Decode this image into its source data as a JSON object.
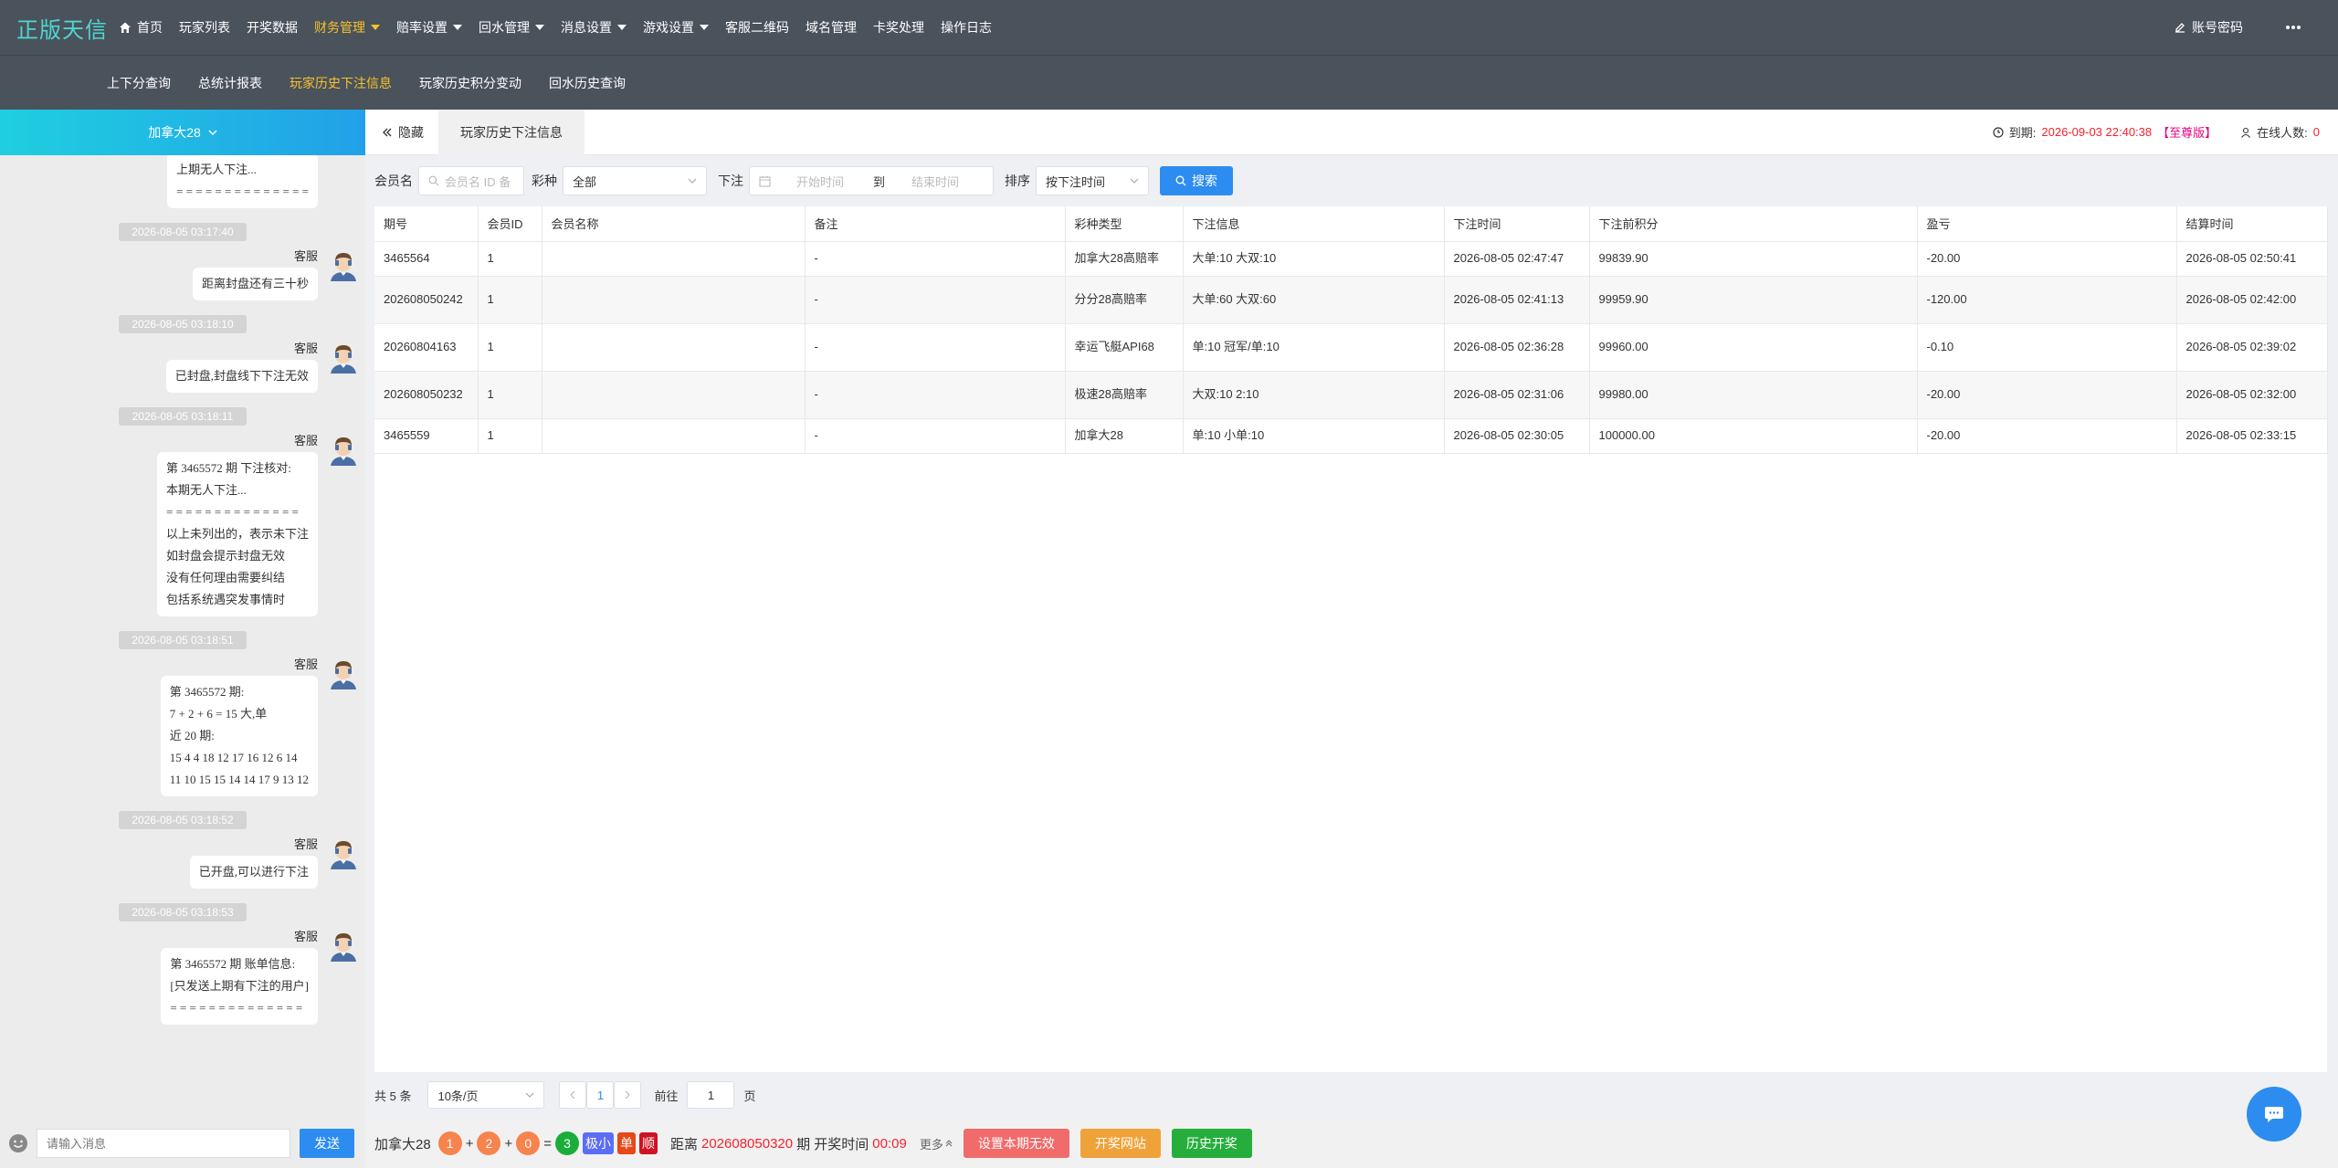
{
  "topbar": {
    "logo": "正版天信",
    "nav": [
      {
        "label": "首页",
        "active": false,
        "caret": false,
        "icon": "home-icon"
      },
      {
        "label": "玩家列表",
        "active": false,
        "caret": false
      },
      {
        "label": "开奖数据",
        "active": false,
        "caret": false
      },
      {
        "label": "财务管理",
        "active": true,
        "caret": true
      },
      {
        "label": "赔率设置",
        "active": false,
        "caret": true
      },
      {
        "label": "回水管理",
        "active": false,
        "caret": true
      },
      {
        "label": "消息设置",
        "active": false,
        "caret": true
      },
      {
        "label": "游戏设置",
        "active": false,
        "caret": true
      },
      {
        "label": "客服二维码",
        "active": false,
        "caret": false
      },
      {
        "label": "域名管理",
        "active": false,
        "caret": false
      },
      {
        "label": "卡奖处理",
        "active": false,
        "caret": false
      },
      {
        "label": "操作日志",
        "active": false,
        "caret": false
      }
    ],
    "account_label": "账号密码",
    "more_icon": "more-icon"
  },
  "subnav": [
    {
      "label": "上下分查询",
      "active": false
    },
    {
      "label": "总统计报表",
      "active": false
    },
    {
      "label": "玩家历史下注信息",
      "active": true
    },
    {
      "label": "玩家历史积分变动",
      "active": false
    },
    {
      "label": "回水历史查询",
      "active": false
    }
  ],
  "chat": {
    "title": "加拿大28",
    "messages": [
      {
        "timestamp": "",
        "sender": "",
        "text": "上期无人下注...\n= = = = = = = = = = = = = ="
      },
      {
        "timestamp": "2026-08-05 03:17:40",
        "sender": "客服",
        "text": "距离封盘还有三十秒"
      },
      {
        "timestamp": "2026-08-05 03:18:10",
        "sender": "客服",
        "text": "已封盘,封盘线下下注无效"
      },
      {
        "timestamp": "2026-08-05 03:18:11",
        "sender": "客服",
        "text": "第 3465572 期 下注核对:\n本期无人下注...\n= = = = = = = = = = = = = =\n以上未列出的，表示未下注\n如封盘会提示封盘无效\n没有任何理由需要纠结\n包括系统遇突发事情时"
      },
      {
        "timestamp": "2026-08-05 03:18:51",
        "sender": "客服",
        "text": "第 3465572 期:\n7 + 2 + 6 = 15 大,单\n近 20 期:\n15 4 4 18 12 17 16 12 6 14\n11 10 15 15 14 14 17 9 13 12"
      },
      {
        "timestamp": "2026-08-05 03:18:52",
        "sender": "客服",
        "text": "已开盘,可以进行下注"
      },
      {
        "timestamp": "2026-08-05 03:18:53",
        "sender": "客服",
        "text": "第 3465572 期 账单信息:\n[只发送上期有下注的用户]\n= = = = = = = = = = = = = ="
      }
    ],
    "input_placeholder": "请输入消息",
    "send_label": "发送"
  },
  "main": {
    "hide_label": "隐藏",
    "tab_label": "玩家历史下注信息",
    "expire_label": "到期:",
    "expire_value": "2026-09-03 22:40:38",
    "expire_level": "【至尊版】",
    "online_label": "在线人数:",
    "online_value": "0"
  },
  "filter": {
    "member_label": "会员名",
    "member_placeholder": "会员名 ID 备",
    "lottery_label": "彩种",
    "lottery_value": "全部",
    "bet_label": "下注",
    "start_placeholder": "开始时间",
    "to_label": "到",
    "end_placeholder": "结束时间",
    "sort_label": "排序",
    "sort_value": "按下注时间",
    "search_label": "搜索"
  },
  "table": {
    "headers": [
      "期号",
      "会员ID",
      "会员名称",
      "备注",
      "彩种类型",
      "下注信息",
      "下注时间",
      "下注前积分",
      "盈亏",
      "结算时间"
    ],
    "rows": [
      [
        "3465564",
        "1",
        "",
        "-",
        "加拿大28高赔率",
        "大单:10 大双:10",
        "2026-08-05 02:47:47",
        "99839.90",
        "-20.00",
        "2026-08-05 02:50:41"
      ],
      [
        "202608050242",
        "1",
        "",
        "-",
        "分分28高赔率",
        "大单:60 大双:60",
        "2026-08-05 02:41:13",
        "99959.90",
        "-120.00",
        "2026-08-05 02:42:00"
      ],
      [
        "20260804163",
        "1",
        "",
        "-",
        "幸运飞艇API68",
        "单:10 冠军/单:10",
        "2026-08-05 02:36:28",
        "99960.00",
        "-0.10",
        "2026-08-05 02:39:02"
      ],
      [
        "202608050232",
        "1",
        "",
        "-",
        "极速28高赔率",
        "大双:10 2:10",
        "2026-08-05 02:31:06",
        "99980.00",
        "-20.00",
        "2026-08-05 02:32:00"
      ],
      [
        "3465559",
        "1",
        "",
        "-",
        "加拿大28",
        "单:10 小单:10",
        "2026-08-05 02:30:05",
        "100000.00",
        "-20.00",
        "2026-08-05 02:33:15"
      ]
    ]
  },
  "pager": {
    "total": "共 5 条",
    "page_size": "10条/页",
    "current": "1",
    "goto_label": "前往",
    "goto_value": "1",
    "page_label": "页"
  },
  "bottombar": {
    "game": "加拿大28",
    "balls": [
      "1",
      "2",
      "0"
    ],
    "plus": "+",
    "eq": "=",
    "sum": "3",
    "tags": [
      "极小",
      "单",
      "顺"
    ],
    "distance_label": "距离",
    "period": "202608050320",
    "period_suffix": "期 开奖时间",
    "countdown": "00:09",
    "more": "更多",
    "btn_invalid": "设置本期无效",
    "btn_site": "开奖网站",
    "btn_history": "历史开奖"
  },
  "colors": {
    "accent": "#2d8cf0",
    "active_nav": "#f7c12b",
    "topbar": "#4a525c",
    "danger": "#f5222d"
  }
}
